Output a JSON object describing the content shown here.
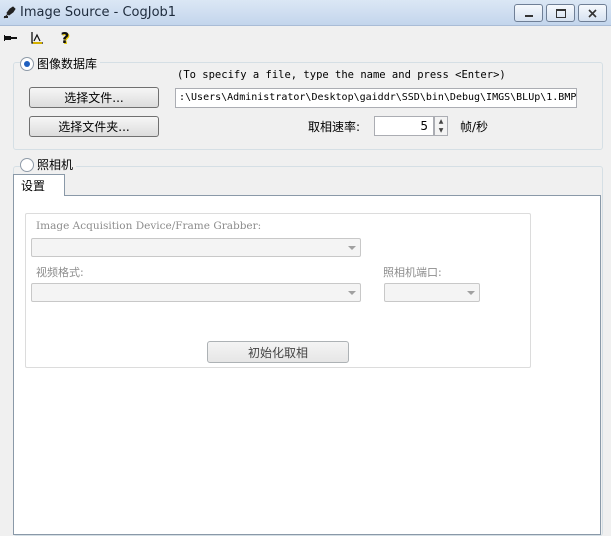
{
  "window": {
    "title": "Image Source - CogJob1",
    "controls": {
      "minimize_icon": "minimize-icon",
      "maximize_icon": "maximize-icon",
      "close_icon": "close-icon"
    }
  },
  "toolbar": {
    "icons": [
      "pin-icon",
      "properties-icon",
      "help-icon"
    ],
    "help_glyph": "?"
  },
  "image_database": {
    "radio_label": "图像数据库",
    "selected": true,
    "select_file_label": "选择文件...",
    "select_folder_label": "选择文件夹...",
    "hint": "(To specify a file, type the name and press <Enter>)",
    "path_value": ":\\Users\\Administrator\\Desktop\\gaiddr\\SSD\\bin\\Debug\\IMGS\\BLUp\\1.BMP",
    "rate_label": "取相速率:",
    "rate_value": "5",
    "rate_unit": "帧/秒"
  },
  "camera": {
    "radio_label": "照相机",
    "selected": false,
    "tabs": [
      {
        "label": "设置",
        "active": true
      }
    ],
    "device_label": "Image Acquisition Device/Frame Grabber:",
    "device_value": "",
    "format_label": "视频格式:",
    "format_value": "",
    "port_label": "照相机端口:",
    "port_value": "",
    "init_button_label": "初始化取相"
  },
  "colors": {
    "titlebar_top": "#dbe7f5",
    "titlebar_bottom": "#c3d5ec",
    "radio_dot": "#1f5fbf",
    "disabled_text": "#8d8d8d"
  }
}
